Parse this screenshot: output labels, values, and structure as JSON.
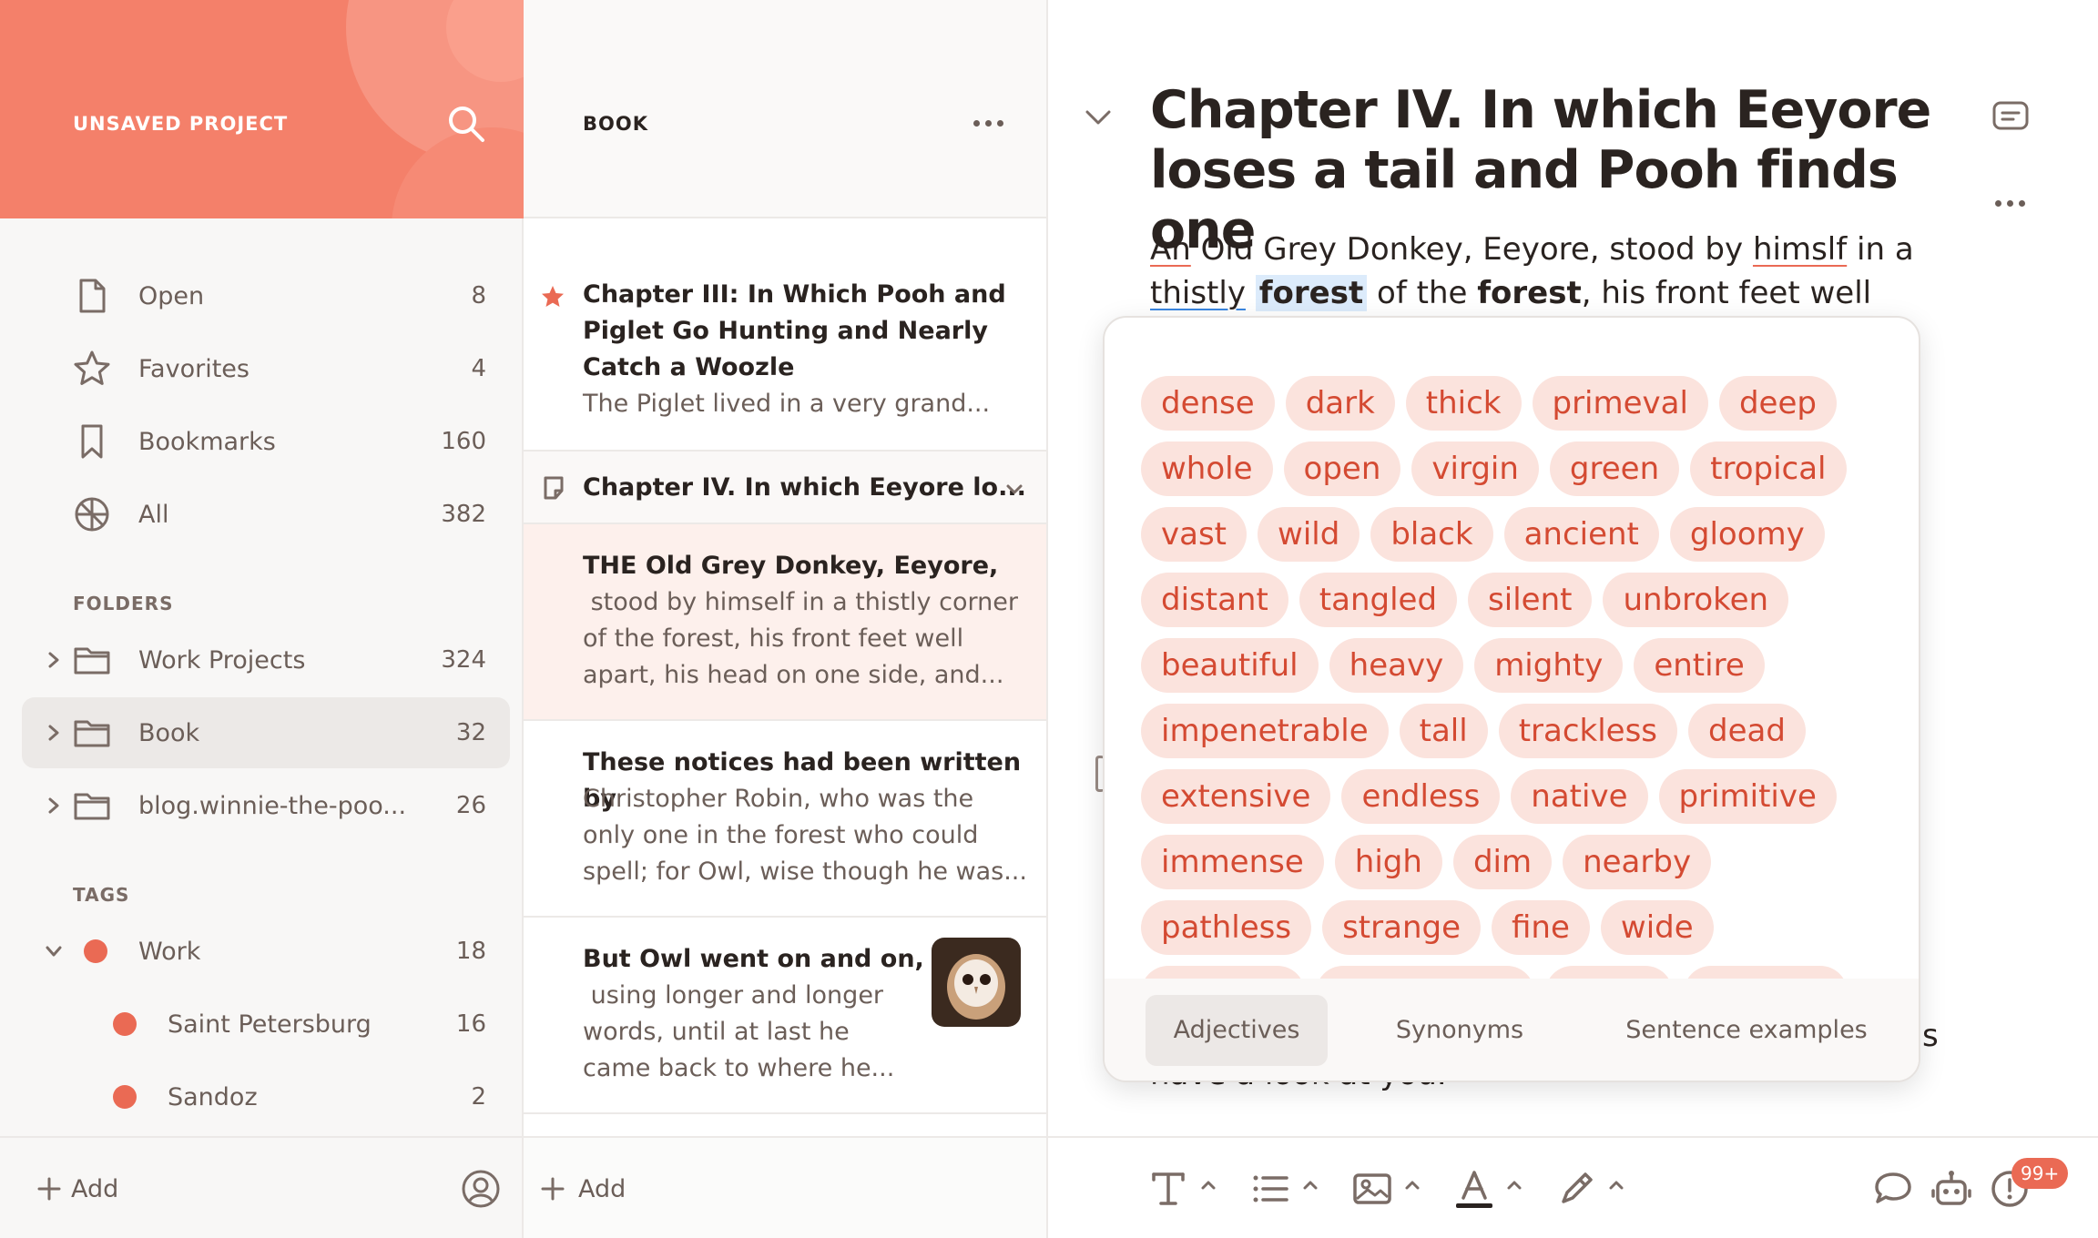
{
  "sidebar": {
    "project_title": "UNSAVED PROJECT",
    "nav": [
      {
        "label": "Open",
        "count": "8",
        "icon": "document-icon"
      },
      {
        "label": "Favorites",
        "count": "4",
        "icon": "star-icon"
      },
      {
        "label": "Bookmarks",
        "count": "160",
        "icon": "bookmark-icon"
      },
      {
        "label": "All",
        "count": "382",
        "icon": "all-notes-icon"
      }
    ],
    "folders_label": "FOLDERS",
    "folders": [
      {
        "label": "Work Projects",
        "count": "324"
      },
      {
        "label": "Book",
        "count": "32"
      },
      {
        "label": "blog.winnie-the-poo...",
        "count": "26"
      }
    ],
    "tags_label": "TAGS",
    "tags": [
      {
        "label": "Work",
        "count": "18"
      },
      {
        "label": "Saint Petersburg",
        "count": "16"
      },
      {
        "label": "Sandoz",
        "count": "2"
      }
    ],
    "add_label": "Add"
  },
  "notelist": {
    "title": "BOOK",
    "notes": [
      {
        "title": [
          "Chapter III: In Which Pooh and",
          "Piglet Go Hunting and Nearly",
          "Catch a Woozle"
        ],
        "preview": [
          "The Piglet lived in a very grand..."
        ]
      },
      {
        "title": [
          "Chapter IV. In which Eeyore lo..."
        ]
      },
      {
        "title": [
          "THE Old Grey Donkey, Eeyore,"
        ],
        "preview": [
          " stood by himself in a thistly corner",
          "of the forest, his front feet well",
          "apart, his head on one side, and..."
        ]
      },
      {
        "title": [
          "These notices had been written by"
        ],
        "preview": [
          "Christopher Robin, who was the",
          "only one in the forest who could",
          "spell; for Owl, wise though he was..."
        ]
      },
      {
        "title": [
          "But Owl went on and on,"
        ],
        "preview": [
          " using longer and longer",
          "words, until at last he",
          "came back to where he..."
        ]
      }
    ],
    "add_label": "Add"
  },
  "editor": {
    "title": "Chapter IV. In which Eeyore loses a tail and Pooh finds one",
    "body": {
      "w1": "An",
      "w2": " Old Grey Donkey, Eeyore, stood by ",
      "w3": "himslf",
      "w4": " in a",
      "w5": "thistly",
      "w6": "forest",
      "w7": " of the ",
      "w8": "forest",
      "w9": ", his front feet well"
    },
    "tail_text": "have a look at you.",
    "tail_s": "s"
  },
  "popup": {
    "rows": [
      [
        "dense",
        "dark",
        "thick",
        "primeval",
        "deep"
      ],
      [
        "whole",
        "open",
        "virgin",
        "green",
        "tropical"
      ],
      [
        "vast",
        "wild",
        "black",
        "ancient",
        "gloomy"
      ],
      [
        "distant",
        "tangled",
        "silent",
        "unbroken"
      ],
      [
        "beautiful",
        "heavy",
        "mighty",
        "entire"
      ],
      [
        "impenetrable",
        "tall",
        "trackless",
        "dead"
      ],
      [
        "extensive",
        "endless",
        "native",
        "primitive"
      ],
      [
        "immense",
        "high",
        "dim",
        "nearby"
      ],
      [
        "pathless",
        "strange",
        "fine",
        "wide"
      ],
      [
        "",
        "",
        "",
        ""
      ]
    ],
    "tabs": [
      "Adjectives",
      "Synonyms",
      "Sentence examples"
    ]
  },
  "toolbar": {
    "badge": "99+"
  },
  "colors": {
    "accent": "#f4806a",
    "tag_dot": "#ea6a54",
    "chip_bg": "#fbe3dd",
    "chip_text": "#d44a32"
  }
}
